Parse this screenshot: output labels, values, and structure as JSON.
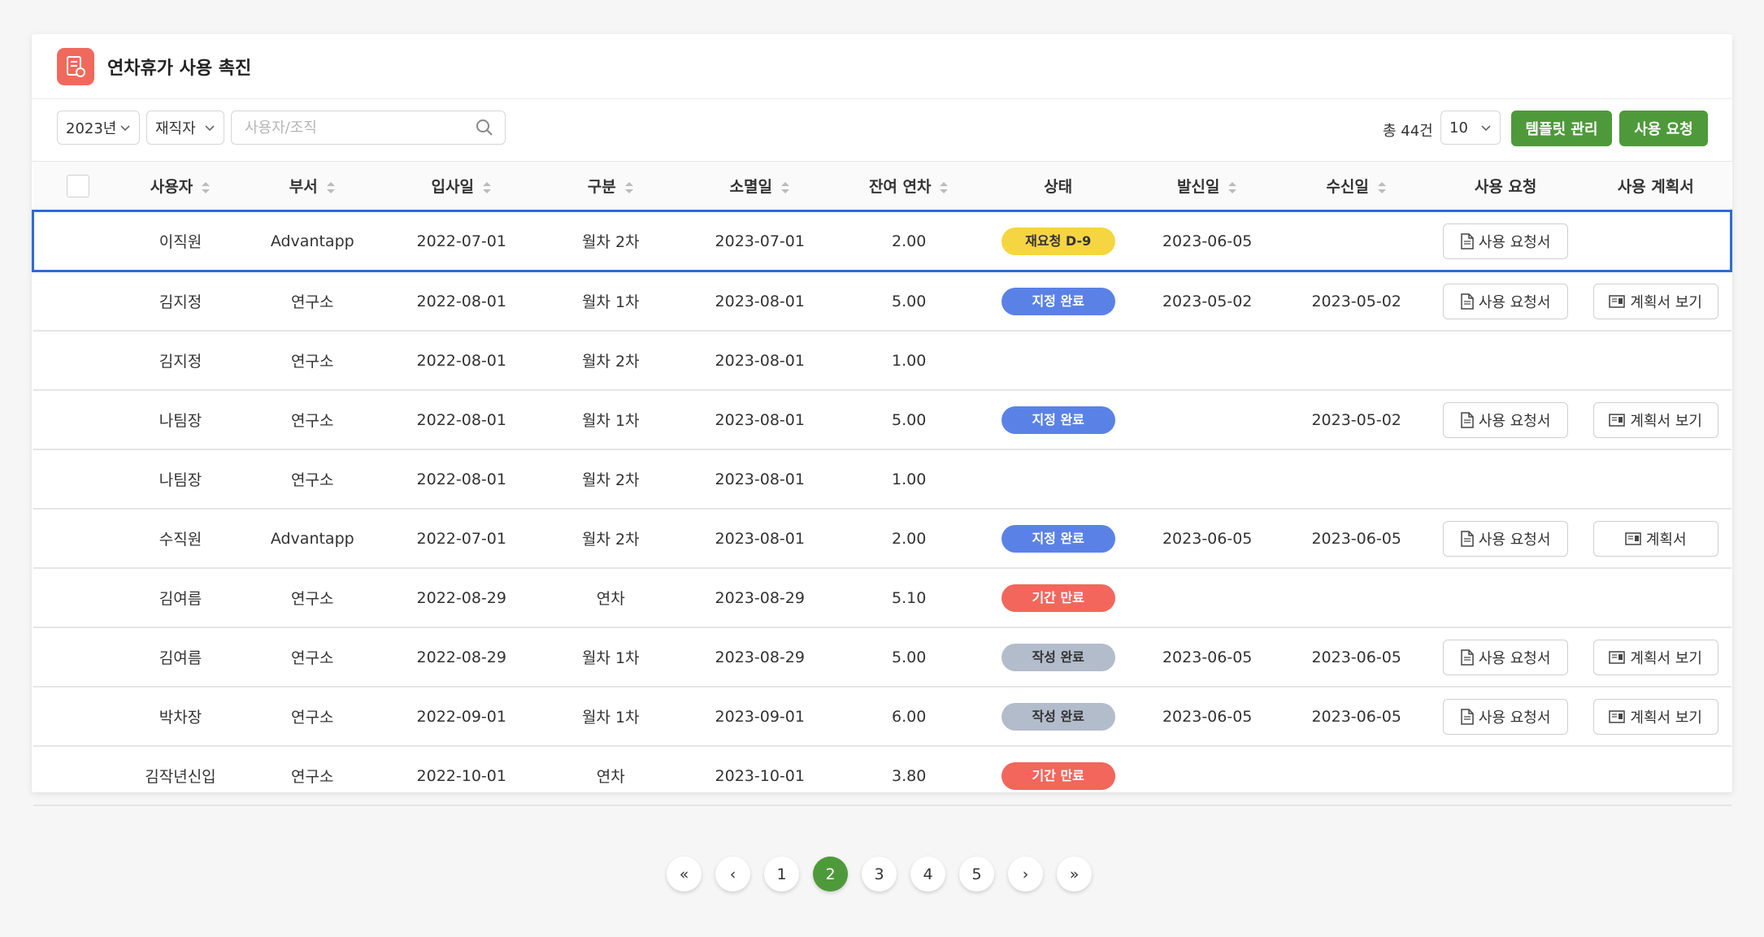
{
  "header": {
    "title": "연차휴가 사용 촉진",
    "icon": "document-icon",
    "icon_color": "#ef6a5c"
  },
  "toolbar": {
    "year_select": "2023년",
    "status_select": "재직자",
    "search_placeholder": "사용자/조직",
    "total_text": "총 44건",
    "page_size": "10",
    "template_button": "템플릿 관리",
    "request_button": "사용 요청"
  },
  "table": {
    "headers": [
      "사용자",
      "부서",
      "입사일",
      "구분",
      "소멸일",
      "잔여 연차",
      "상태",
      "발신일",
      "수신일",
      "사용 요청",
      "사용 계획서"
    ],
    "rows": [
      {
        "user": "이직원",
        "dept": "Advantapp",
        "join": "2022-07-01",
        "type": "월차 2차",
        "expire": "2023-07-01",
        "remain": "2.00",
        "status": "재요청 D-9",
        "status_color": "yellow",
        "sent": "2023-06-05",
        "received": "",
        "req_btn": "사용 요청서",
        "plan_btn": ""
      },
      {
        "user": "김지정",
        "dept": "연구소",
        "join": "2022-08-01",
        "type": "월차 1차",
        "expire": "2023-08-01",
        "remain": "5.00",
        "status": "지정 완료",
        "status_color": "blue",
        "sent": "2023-05-02",
        "received": "2023-05-02",
        "req_btn": "사용 요청서",
        "plan_btn": "계획서 보기"
      },
      {
        "user": "김지정",
        "dept": "연구소",
        "join": "2022-08-01",
        "type": "월차 2차",
        "expire": "2023-08-01",
        "remain": "1.00",
        "status": "",
        "status_color": "",
        "sent": "",
        "received": "",
        "req_btn": "",
        "plan_btn": ""
      },
      {
        "user": "나팀장",
        "dept": "연구소",
        "join": "2022-08-01",
        "type": "월차 1차",
        "expire": "2023-08-01",
        "remain": "5.00",
        "status": "지정 완료",
        "status_color": "blue",
        "sent": "",
        "received": "2023-05-02",
        "req_btn": "사용 요청서",
        "plan_btn": "계획서 보기"
      },
      {
        "user": "나팀장",
        "dept": "연구소",
        "join": "2022-08-01",
        "type": "월차 2차",
        "expire": "2023-08-01",
        "remain": "1.00",
        "status": "",
        "status_color": "",
        "sent": "",
        "received": "",
        "req_btn": "",
        "plan_btn": ""
      },
      {
        "user": "수직원",
        "dept": "Advantapp",
        "join": "2022-07-01",
        "type": "월차 2차",
        "expire": "2023-08-01",
        "remain": "2.00",
        "status": "지정 완료",
        "status_color": "blue",
        "sent": "2023-06-05",
        "received": "2023-06-05",
        "req_btn": "사용 요청서",
        "plan_btn": "계획서"
      },
      {
        "user": "김여름",
        "dept": "연구소",
        "join": "2022-08-29",
        "type": "연차",
        "expire": "2023-08-29",
        "remain": "5.10",
        "status": "기간 만료",
        "status_color": "red",
        "sent": "",
        "received": "",
        "req_btn": "",
        "plan_btn": ""
      },
      {
        "user": "김여름",
        "dept": "연구소",
        "join": "2022-08-29",
        "type": "월차 1차",
        "expire": "2023-08-29",
        "remain": "5.00",
        "status": "작성 완료",
        "status_color": "gray",
        "sent": "2023-06-05",
        "received": "2023-06-05",
        "req_btn": "사용 요청서",
        "plan_btn": "계획서 보기"
      },
      {
        "user": "박차장",
        "dept": "연구소",
        "join": "2022-09-01",
        "type": "월차 1차",
        "expire": "2023-09-01",
        "remain": "6.00",
        "status": "작성 완료",
        "status_color": "gray",
        "sent": "2023-06-05",
        "received": "2023-06-05",
        "req_btn": "사용 요청서",
        "plan_btn": "계획서 보기"
      },
      {
        "user": "김작년신입",
        "dept": "연구소",
        "join": "2022-10-01",
        "type": "연차",
        "expire": "2023-10-01",
        "remain": "3.80",
        "status": "기간 만료",
        "status_color": "red",
        "sent": "",
        "received": "",
        "req_btn": "",
        "plan_btn": ""
      }
    ]
  },
  "pagination": {
    "first": "«",
    "prev": "‹",
    "pages": [
      "1",
      "2",
      "3",
      "4",
      "5"
    ],
    "current": "2",
    "next": "›",
    "last": "»"
  },
  "colors": {
    "accent_green": "#4e9a3a",
    "selected_border": "#2e6bd3"
  }
}
